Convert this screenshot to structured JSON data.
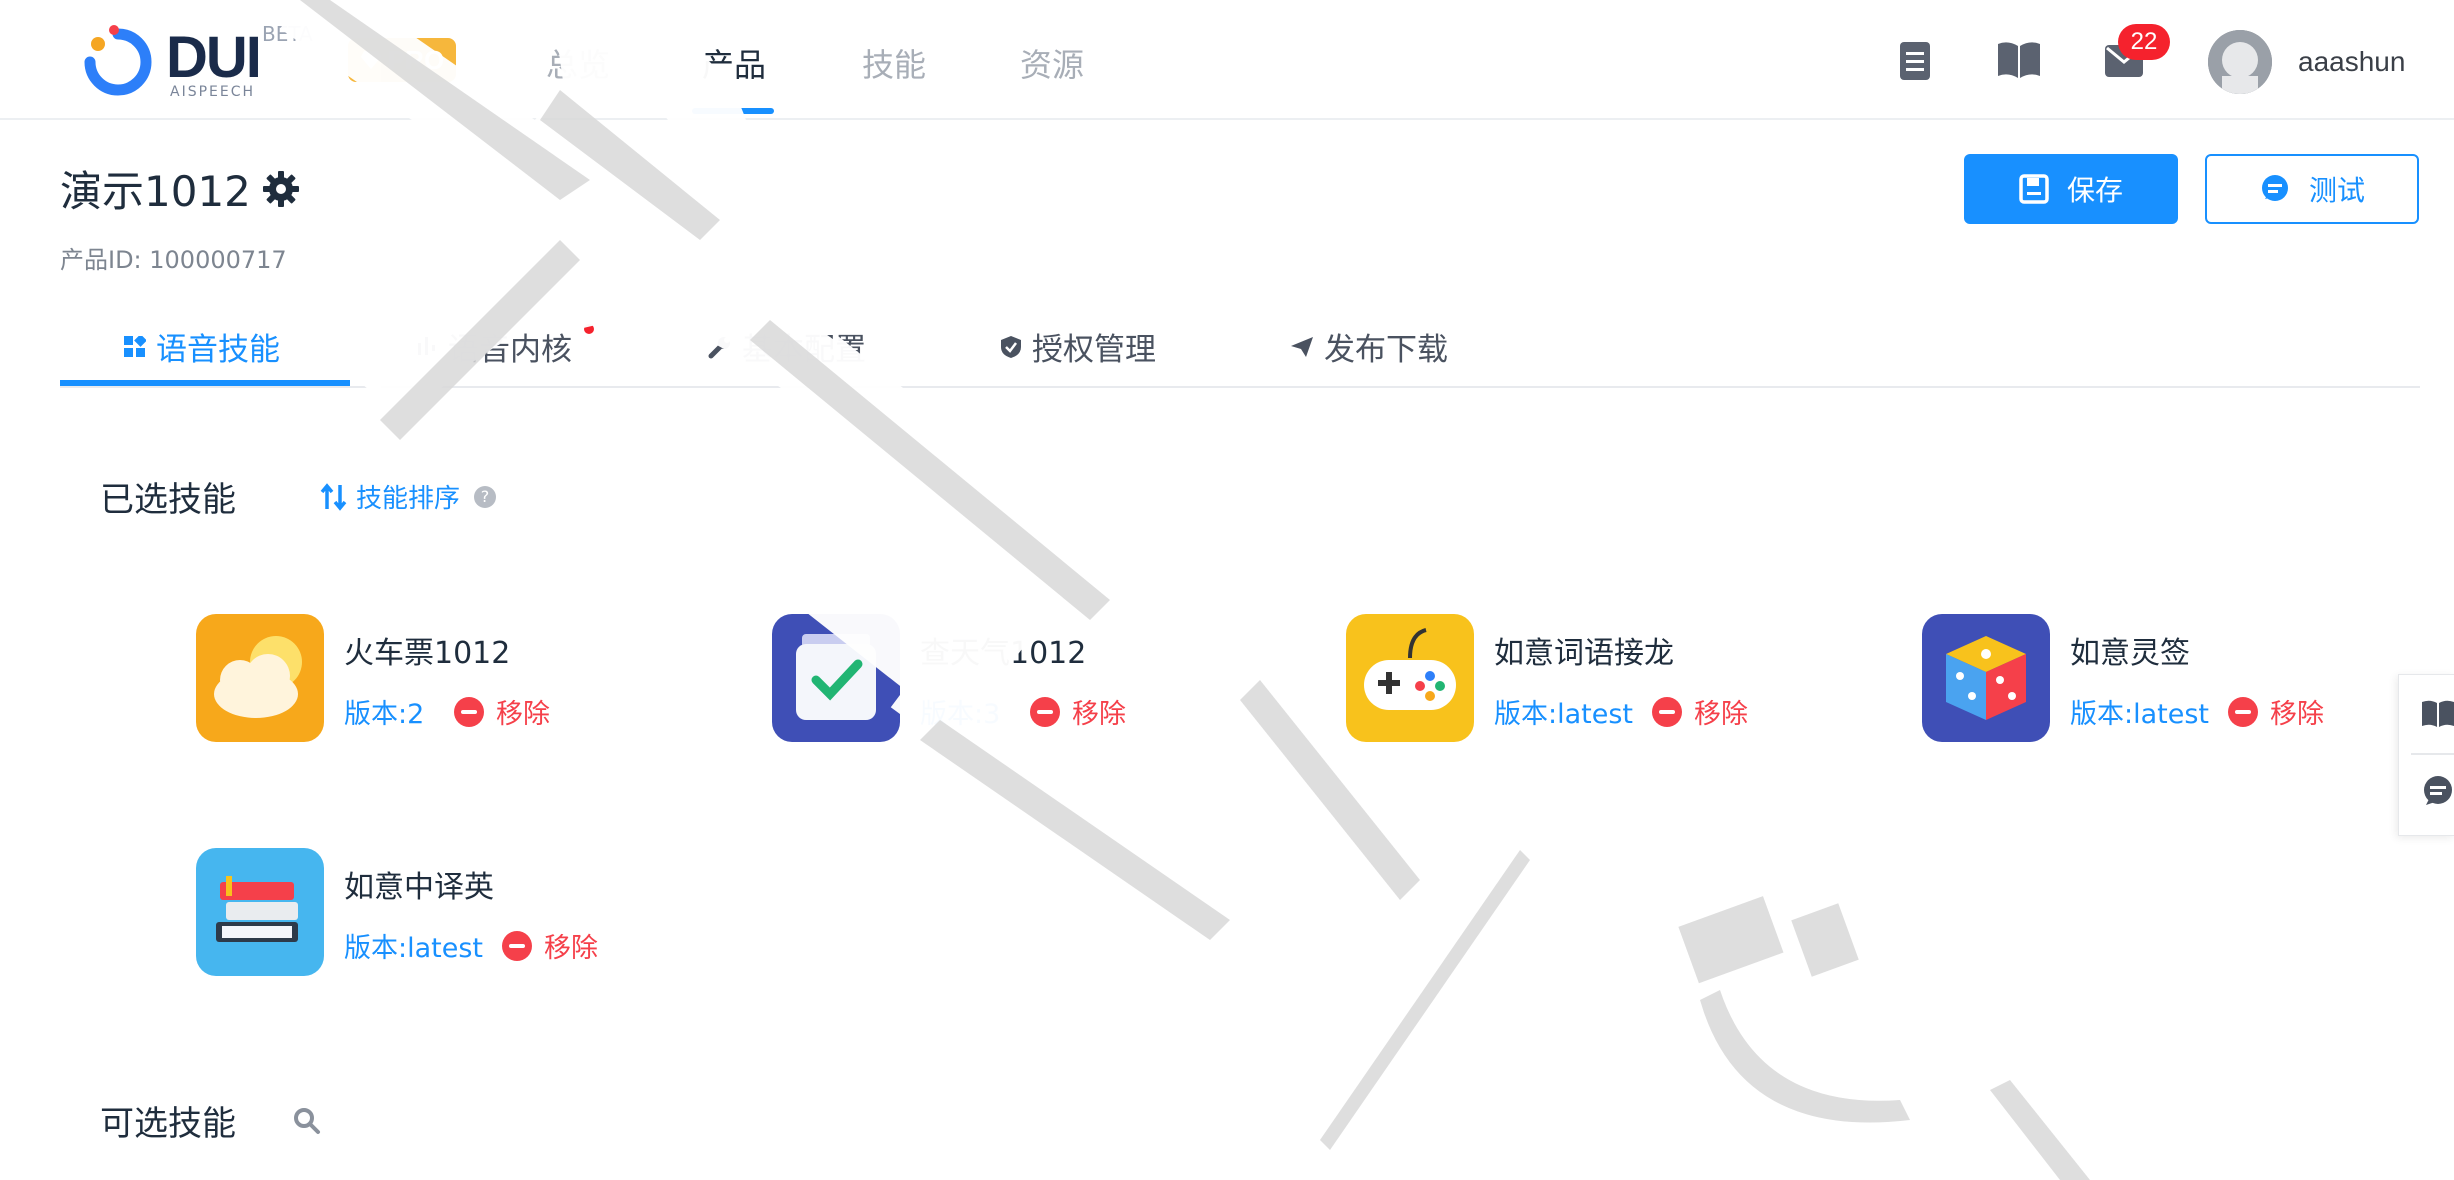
{
  "nav": {
    "logo": {
      "text": "DUI",
      "sub": "AISPEECH",
      "beta": "BETA"
    },
    "pro_badge": "PRO",
    "items": [
      {
        "label": "总览",
        "active": false
      },
      {
        "label": "产品",
        "active": true
      },
      {
        "label": "技能",
        "active": false
      },
      {
        "label": "资源",
        "active": false
      }
    ],
    "icons": [
      "document-icon",
      "book-icon",
      "mail-icon"
    ],
    "notification_count": "22",
    "username": "aaashun"
  },
  "header": {
    "title": "演示1012",
    "product_id": "产品ID: 100000717",
    "save_label": "保存",
    "test_label": "测试"
  },
  "tabs": [
    {
      "label": "语音技能",
      "icon": "grid-icon",
      "active": true
    },
    {
      "label": "语音内核",
      "icon": "signal-icon",
      "active": false,
      "dot": true
    },
    {
      "label": "基本配置",
      "icon": "wrench-icon",
      "active": false
    },
    {
      "label": "授权管理",
      "icon": "shield-icon",
      "active": false
    },
    {
      "label": "发布下载",
      "icon": "send-icon",
      "active": false
    }
  ],
  "selected": {
    "title": "已选技能",
    "sort_label": "技能排序",
    "help": "?",
    "remove_label": "移除",
    "skills": [
      {
        "name": "火车票1012",
        "version": "版本:2",
        "icon": "weather-cloud-icon"
      },
      {
        "name": "查天气1012",
        "version": "版本:3",
        "icon": "checkbox-card-icon"
      },
      {
        "name": "如意词语接龙",
        "version": "版本:latest",
        "icon": "gamepad-icon"
      },
      {
        "name": "如意灵签",
        "version": "版本:latest",
        "icon": "dice-icon"
      },
      {
        "name": "如意中译英",
        "version": "版本:latest",
        "icon": "books-icon"
      }
    ]
  },
  "available": {
    "title": "可选技能"
  },
  "colors": {
    "accent": "#1890ff",
    "danger": "#f5404a",
    "pro": "#f6b73c"
  }
}
